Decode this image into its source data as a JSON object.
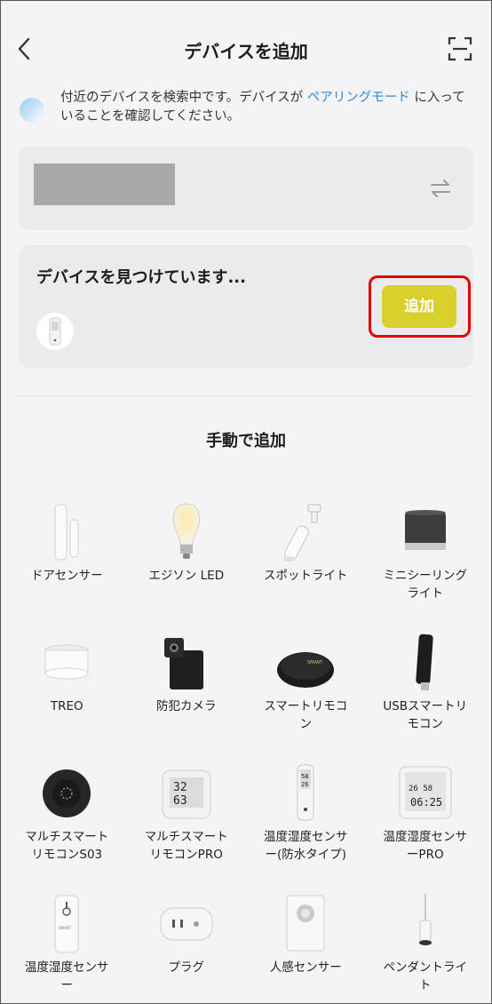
{
  "header": {
    "title": "デバイスを追加"
  },
  "notice": {
    "text_before": "付近のデバイスを検索中です。デバイスが ",
    "link": "ペアリングモード",
    "text_after": " に入っていることを確認してください。"
  },
  "found": {
    "title": "デバイスを見つけています...",
    "add_label": "追加"
  },
  "manual": {
    "title": "手動で追加",
    "devices": [
      {
        "label": "ドアセンサー",
        "icon": "door-sensor-icon"
      },
      {
        "label": "エジソン LED",
        "icon": "edison-bulb-icon"
      },
      {
        "label": "スポットライト",
        "icon": "spotlight-icon"
      },
      {
        "label": "ミニシーリング\nライト",
        "icon": "mini-ceiling-light-icon"
      },
      {
        "label": "TREO",
        "icon": "treo-light-icon"
      },
      {
        "label": "防犯カメラ",
        "icon": "security-camera-icon"
      },
      {
        "label": "スマートリモコ\nン",
        "icon": "smart-remote-icon"
      },
      {
        "label": "USBスマートリ\nモコン",
        "icon": "usb-remote-icon"
      },
      {
        "label": "マルチスマート\nリモコンS03",
        "icon": "multi-remote-s03-icon"
      },
      {
        "label": "マルチスマート\nリモコンPRO",
        "icon": "multi-remote-pro-icon"
      },
      {
        "label": "温度湿度センサ\nー(防水タイプ)",
        "icon": "waterproof-thermo-icon"
      },
      {
        "label": "温度湿度センサ\nーPRO",
        "icon": "thermo-pro-icon"
      },
      {
        "label": "温度湿度センサ\nー",
        "icon": "thermo-sensor-icon"
      },
      {
        "label": "プラグ",
        "icon": "plug-icon"
      },
      {
        "label": "人感センサー",
        "icon": "motion-sensor-icon"
      },
      {
        "label": "ペンダントライ\nト",
        "icon": "pendant-light-icon"
      }
    ]
  },
  "colors": {
    "accent": "#d9cf2d",
    "link": "#2d8ad6",
    "highlight": "#e30000"
  }
}
